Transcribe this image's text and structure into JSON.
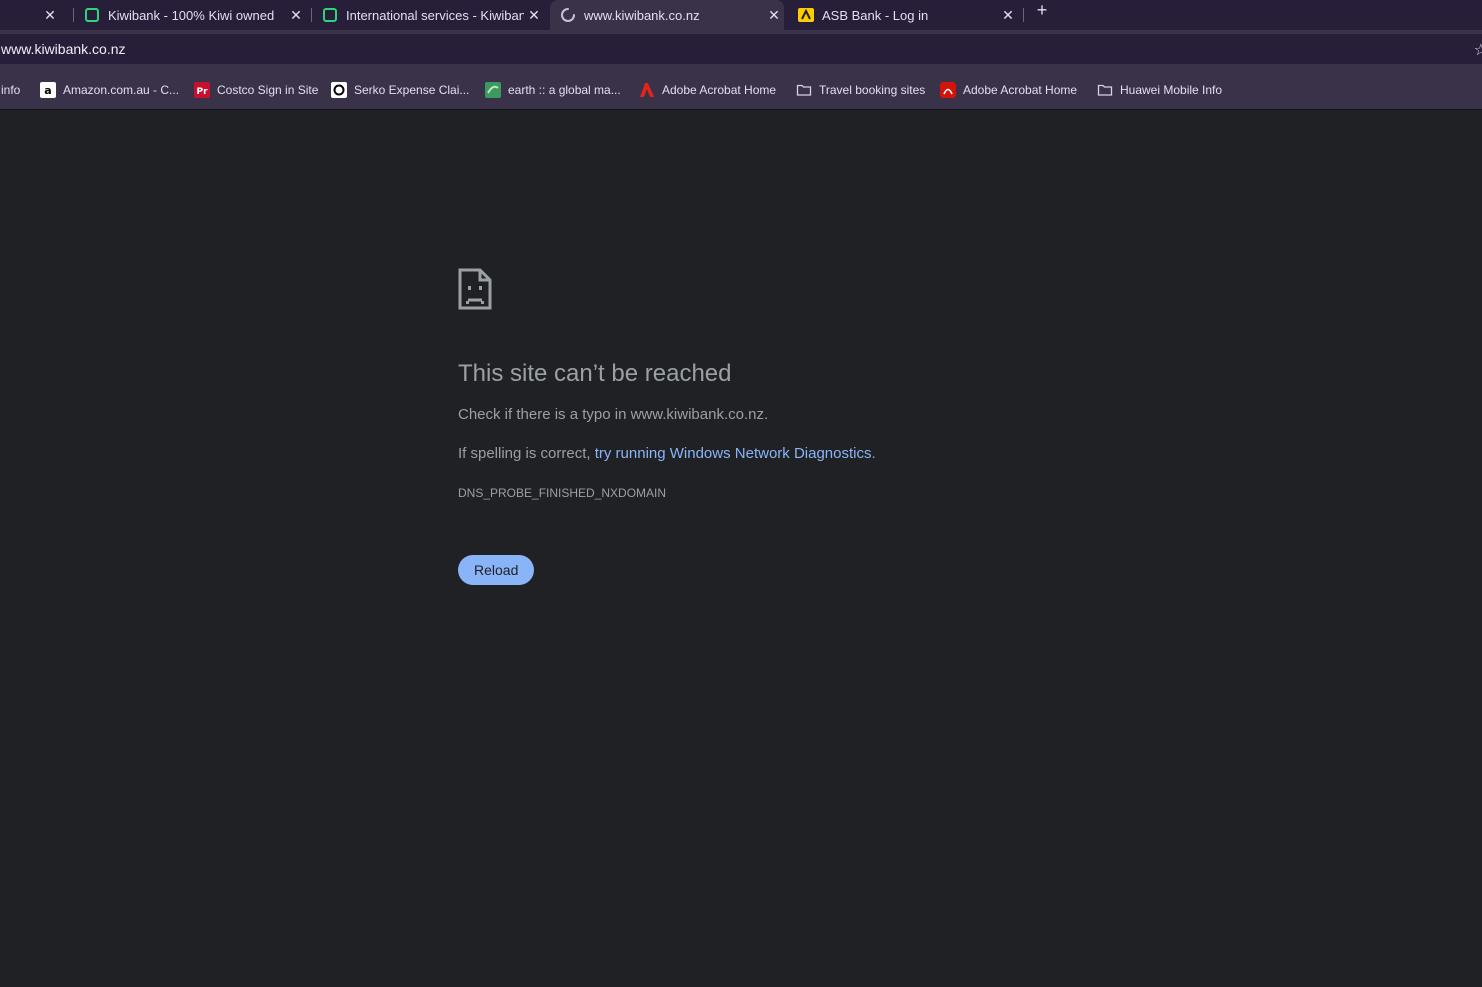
{
  "tabs": [
    {
      "title": "Kiwibank - 100% Kiwi owned",
      "icon": "kiwibank-icon"
    },
    {
      "title": "International services - Kiwibank",
      "icon": "kiwibank-icon"
    },
    {
      "title": "www.kiwibank.co.nz",
      "icon": "loading-spinner-icon",
      "active": true
    },
    {
      "title": "ASB Bank - Log in",
      "icon": "asb-icon"
    }
  ],
  "tab_close_glyph": "✕",
  "new_tab_glyph": "+",
  "address_bar": {
    "url": "www.kiwibank.co.nz"
  },
  "bookmarks": [
    {
      "label": "info"
    },
    {
      "label": "Amazon.com.au - C...",
      "icon": "amazon-icon"
    },
    {
      "label": "Costco Sign in Site",
      "icon": "costco-icon"
    },
    {
      "label": "Serko Expense Clai...",
      "icon": "serko-icon"
    },
    {
      "label": "earth :: a global ma...",
      "icon": "earth-icon"
    },
    {
      "label": "Adobe Acrobat Home",
      "icon": "adobe-icon"
    },
    {
      "label": "Travel booking sites",
      "icon": "folder-icon"
    },
    {
      "label": "Adobe Acrobat Home",
      "icon": "acrobat-icon"
    },
    {
      "label": "Huawei Mobile Info",
      "icon": "folder-icon"
    }
  ],
  "error": {
    "title": "This site can’t be reached",
    "line1": "Check if there is a typo in www.kiwibank.co.nz.",
    "line2_prefix": "If spelling is correct, ",
    "line2_link": "try running Windows Network Diagnostics",
    "line2_suffix": ".",
    "code": "DNS_PROBE_FINISHED_NXDOMAIN",
    "reload_label": "Reload"
  },
  "colors": {
    "link": "#8ab4f8",
    "button": "#8ab4f8",
    "page_bg": "#202124",
    "frame": "#271e3a"
  }
}
